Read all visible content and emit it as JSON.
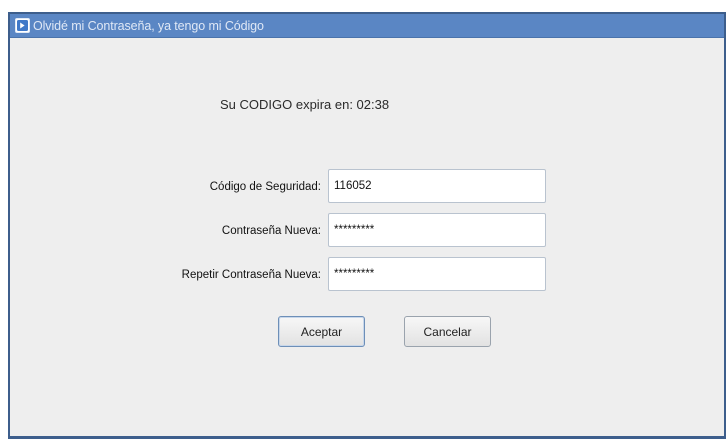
{
  "window": {
    "title": "Olvidé mi Contraseña, ya tengo mi Código"
  },
  "timer": {
    "text": "Su CODIGO expira en:  02:38"
  },
  "form": {
    "security_code_label": "Código de Seguridad:",
    "security_code_value": "116052",
    "new_password_label": "Contraseña Nueva:",
    "new_password_value": "*********",
    "repeat_password_label": "Repetir Contraseña Nueva:",
    "repeat_password_value": "*********"
  },
  "buttons": {
    "accept_label": "Aceptar",
    "cancel_label": "Cancelar"
  },
  "colors": {
    "titlebar": "#5a86c4",
    "window_border": "#3d5e8c",
    "body_background": "#eeeeee"
  },
  "icons": {
    "title_icon": "app-window-icon"
  }
}
